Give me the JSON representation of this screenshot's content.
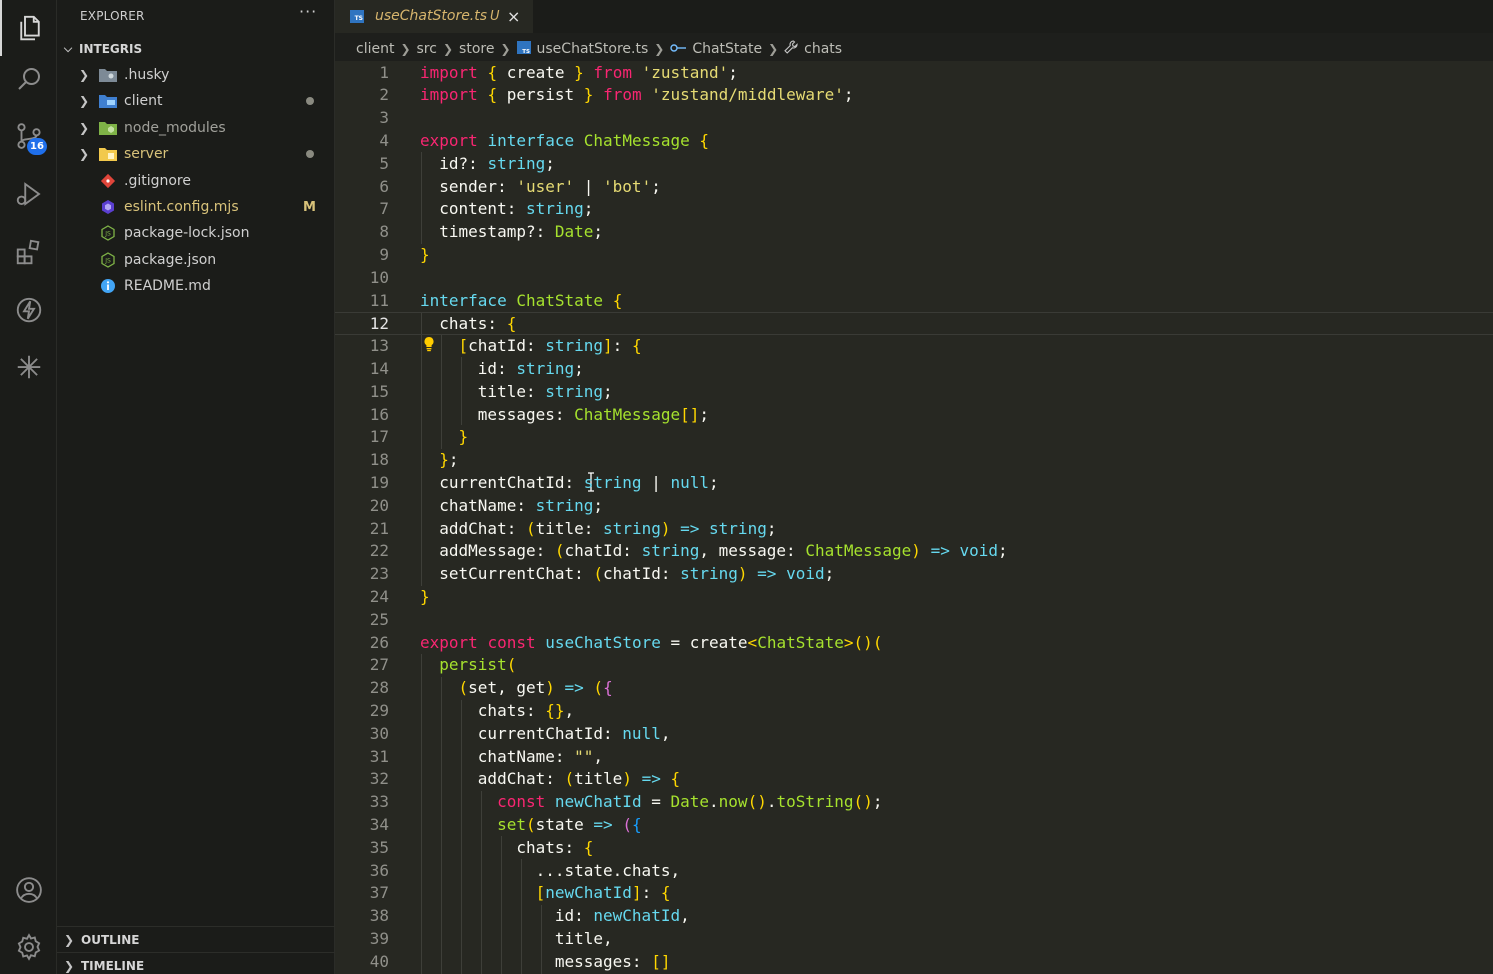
{
  "sidebar": {
    "title": "EXPLORER",
    "more": "···",
    "root": "INTEGRIS",
    "items": [
      {
        "name": ".husky",
        "kind": "folder",
        "status": ""
      },
      {
        "name": "client",
        "kind": "folder",
        "status": "dot"
      },
      {
        "name": "node_modules",
        "kind": "folder",
        "status": ""
      },
      {
        "name": "server",
        "kind": "folder",
        "status": "dot"
      },
      {
        "name": ".gitignore",
        "kind": "file",
        "status": ""
      },
      {
        "name": "eslint.config.mjs",
        "kind": "file",
        "status": "M"
      },
      {
        "name": "package-lock.json",
        "kind": "file",
        "status": ""
      },
      {
        "name": "package.json",
        "kind": "file",
        "status": ""
      },
      {
        "name": "README.md",
        "kind": "file",
        "status": ""
      }
    ],
    "outline": "OUTLINE",
    "timeline": "TIMELINE"
  },
  "activity": {
    "scm_badge": "16"
  },
  "tab": {
    "name": "useChatStore.ts",
    "status": "U",
    "close": "×"
  },
  "breadcrumb": {
    "parts": [
      "client",
      "src",
      "store",
      "useChatStore.ts",
      "ChatState",
      "chats"
    ]
  },
  "editor": {
    "current_line": 12,
    "line_numbers": [
      "1",
      "2",
      "3",
      "4",
      "5",
      "6",
      "7",
      "8",
      "9",
      "10",
      "11",
      "12",
      "13",
      "14",
      "15",
      "16",
      "17",
      "18",
      "19",
      "20",
      "21",
      "22",
      "23",
      "24",
      "25",
      "26",
      "27",
      "28",
      "29",
      "30",
      "31",
      "32",
      "33",
      "34",
      "35",
      "36",
      "37",
      "38",
      "39",
      "40"
    ],
    "lines": [
      "import { create } from 'zustand';",
      "import { persist } from 'zustand/middleware';",
      "",
      "export interface ChatMessage {",
      "  id?: string;",
      "  sender: 'user' | 'bot';",
      "  content: string;",
      "  timestamp?: Date;",
      "}",
      "",
      "interface ChatState {",
      "  chats: {",
      "    [chatId: string]: {",
      "      id: string;",
      "      title: string;",
      "      messages: ChatMessage[];",
      "    }",
      "  };",
      "  currentChatId: string | null;",
      "  chatName: string;",
      "  addChat: (title: string) => string;",
      "  addMessage: (chatId: string, message: ChatMessage) => void;",
      "  setCurrentChat: (chatId: string) => void;",
      "}",
      "",
      "export const useChatStore = create<ChatState>()(",
      "  persist(",
      "    (set, get) => ({",
      "      chats: {},",
      "      currentChatId: null,",
      "      chatName: \"\",",
      "      addChat: (title) => {",
      "        const newChatId = Date.now().toString();",
      "        set(state => ({",
      "          chats: {",
      "            ...state.chats,",
      "            [newChatId]: {",
      "              id: newChatId,",
      "              title,",
      "              messages: []"
    ]
  }
}
